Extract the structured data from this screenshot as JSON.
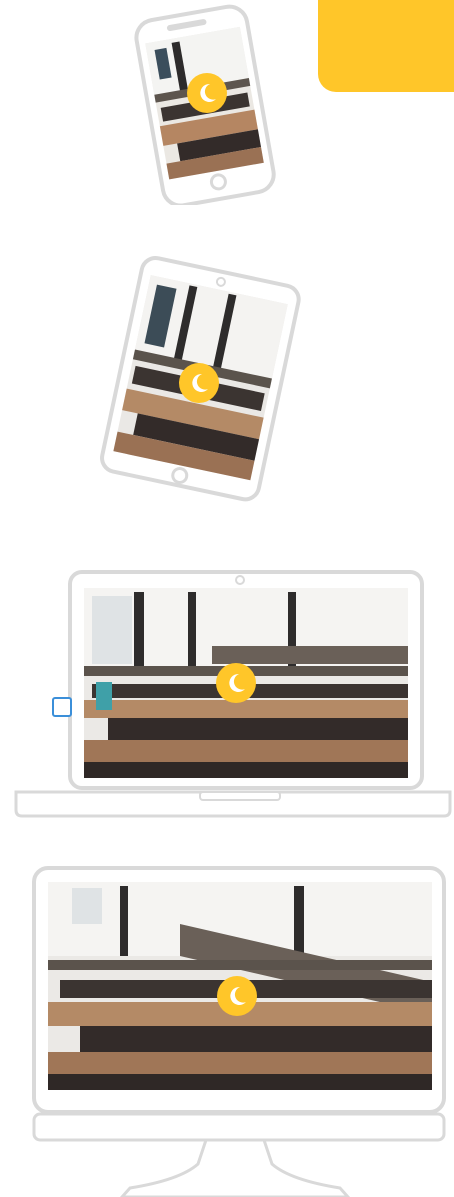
{
  "colors": {
    "accent": "#FFC629",
    "device_outline": "#d9d9d9",
    "wood": "#b48a66",
    "dark_table": "#3a3432",
    "wall": "#e9ecee",
    "window": "#f7f7f6",
    "focus": "#3b8fd9"
  },
  "icons": {
    "badge": "crescent-moon-icon"
  },
  "devices": [
    {
      "name": "phone"
    },
    {
      "name": "tablet"
    },
    {
      "name": "laptop"
    },
    {
      "name": "desktop-monitor"
    }
  ]
}
